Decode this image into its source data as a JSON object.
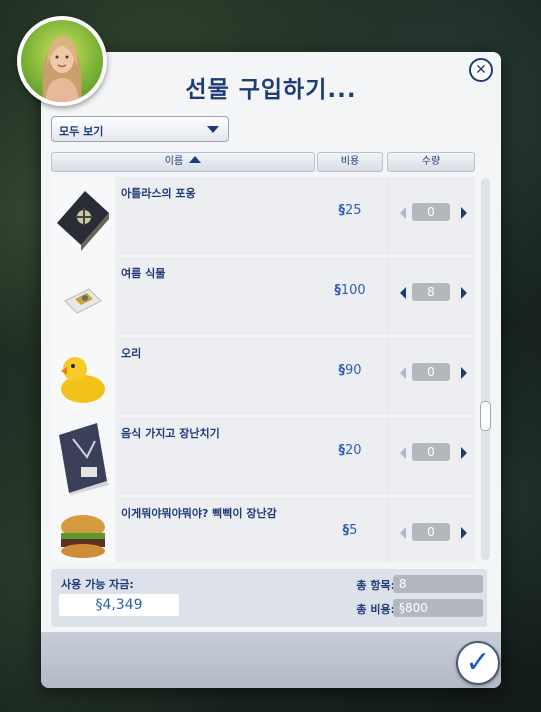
{
  "dialog": {
    "title": "선물 구입하기...",
    "close_icon": "close-icon",
    "filter": {
      "selected": "모두 보기"
    },
    "columns": {
      "name": "이름",
      "cost": "비용",
      "quantity": "수량"
    },
    "items": [
      {
        "name": "아틀라스의 포옹",
        "currency": "§",
        "price": "25",
        "quantity": "0"
      },
      {
        "name": "여름 식물",
        "currency": "§",
        "price": "100",
        "quantity": "8"
      },
      {
        "name": "오리",
        "currency": "§",
        "price": "90",
        "quantity": "0"
      },
      {
        "name": "음식 가지고 장난치기",
        "currency": "§",
        "price": "20",
        "quantity": "0"
      },
      {
        "name": "이게뭐야뭐야뭐야? 삑삑이 장난감",
        "currency": "§",
        "price": "5",
        "quantity": "0"
      }
    ],
    "summary": {
      "funds_label": "사용 가능 자금:",
      "funds_value": "§4,349",
      "total_items_label": "총 항목:",
      "total_items_value": "8",
      "total_cost_label": "총 비용:",
      "total_cost_value": "§800"
    }
  },
  "colors": {
    "accent": "#1f3c7a",
    "price": "#2f5fae",
    "panel": "#f4f5f7"
  }
}
